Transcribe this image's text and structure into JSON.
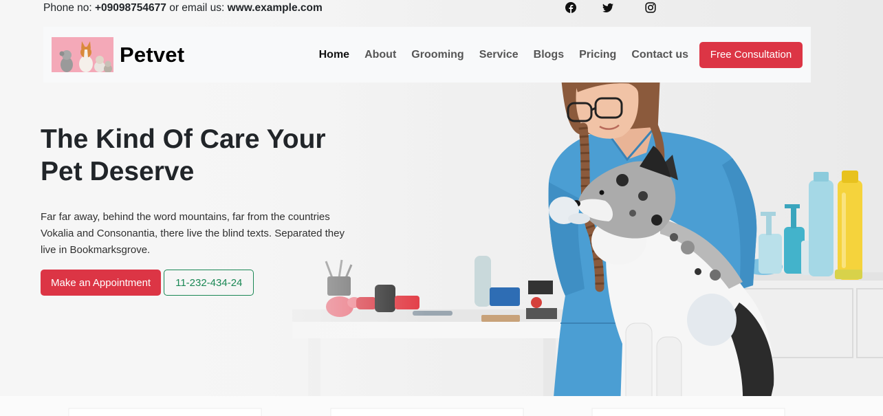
{
  "topbar": {
    "phone_label": "Phone no:",
    "phone": "+09098754677",
    "email_label": "or email us:",
    "email": "www.example.com",
    "social": [
      {
        "icon": "facebook-icon"
      },
      {
        "icon": "twitter-icon"
      },
      {
        "icon": "instagram-icon"
      }
    ]
  },
  "nav": {
    "logo_icon": "pets-logo-image",
    "brand": "Petvet",
    "links": [
      {
        "label": "Home",
        "active": true
      },
      {
        "label": "About"
      },
      {
        "label": "Grooming"
      },
      {
        "label": "Service"
      },
      {
        "label": "Blogs"
      },
      {
        "label": "Pricing"
      },
      {
        "label": "Contact us"
      }
    ],
    "cta": "Free Consultation"
  },
  "hero": {
    "title_line1": "The Kind Of Care Your",
    "title_line2": "Pet Deserve",
    "text": "Far far away, behind the word mountains, far from the countries Vokalia and Consonantia, there live the blind texts. Separated they live in Bookmarksgrove.",
    "primary_button": "Make an Appointment",
    "phone_button": "11-232-434-24",
    "image": "veterinarian-with-dog-photo"
  },
  "colors": {
    "primary_red": "#dc3545",
    "success_green": "#198754",
    "navbar_bg": "#f8f9fa",
    "text_dark": "#212529"
  }
}
